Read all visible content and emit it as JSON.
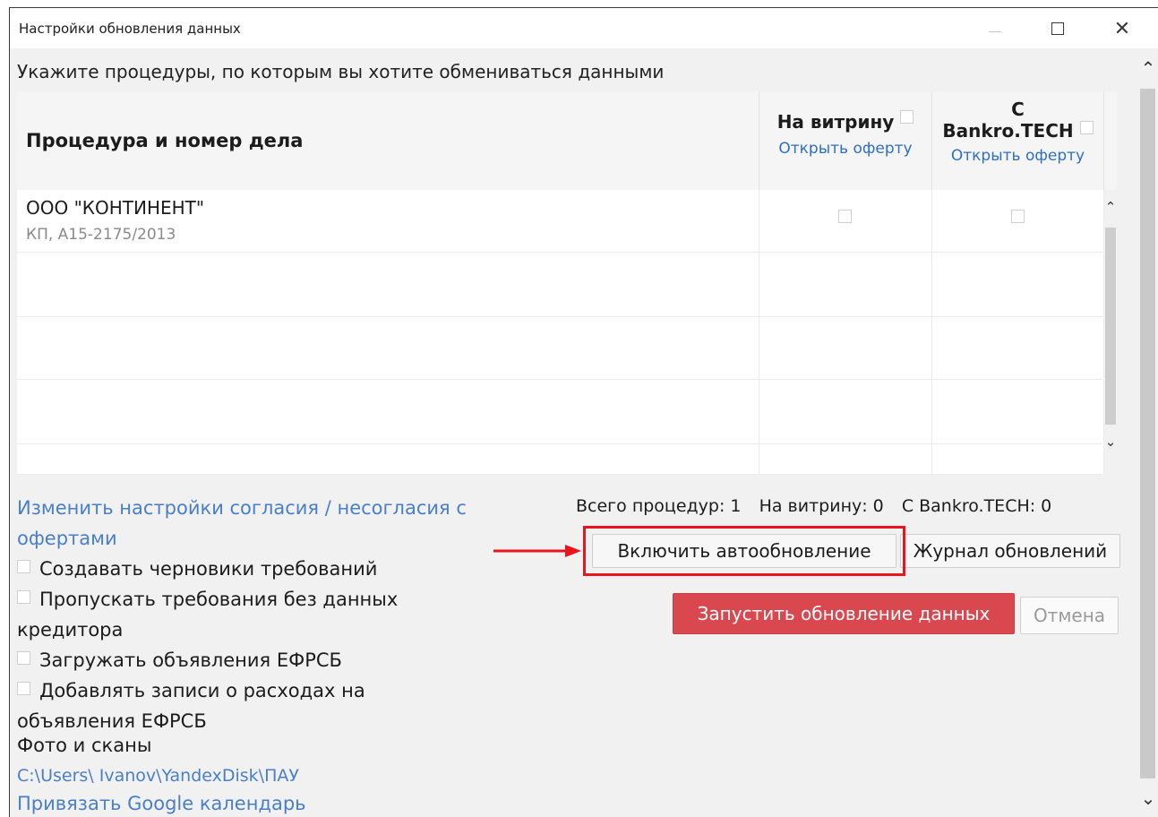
{
  "window": {
    "title": "Настройки обновления данных",
    "close_glyph": "✕"
  },
  "instructions": "Укажите процедуры, по которым вы хотите обмениваться данными",
  "table": {
    "header_procedure": "Процедура и номер дела",
    "header_showcase": "На витрину",
    "header_bankro_line1": "С",
    "header_bankro_line2": "Bankro.TECH",
    "offer_link": "Открыть оферту",
    "rows": [
      {
        "name": "ООО \"КОНТИНЕНТ\"",
        "case": "КП, А15-2175/2013",
        "showcase": false,
        "bankro": false
      }
    ]
  },
  "left_panel": {
    "consent_link": "Изменить настройки согласия / несогласия с офертами",
    "options": [
      {
        "label": "Создавать черновики требований",
        "checked": false
      },
      {
        "label": "Пропускать требования без данных кредитора",
        "checked": false
      },
      {
        "label": "Загружать объявления ЕФРСБ",
        "checked": false
      },
      {
        "label": "Добавлять записи о расходах на объявления ЕФРСБ",
        "checked": false
      }
    ],
    "photos_label": "Фото и сканы",
    "photos_path": "C:\\Users\\ Ivanov\\YandexDisk\\ПАУ",
    "google_calendar_link": "Привязать Google календарь"
  },
  "counts": {
    "total": "Всего процедур: 1",
    "showcase": "На витрину: 0",
    "bankro": "С Bankro.TECH: 0"
  },
  "buttons": {
    "auto_update": "Включить автообновление",
    "update_log": "Журнал обновлений",
    "run_update": "Запустить обновление данных",
    "cancel": "Отмена"
  },
  "colors": {
    "run_button": "#d9474f",
    "link": "#4a7fc8",
    "annotation": "#e8151d"
  }
}
